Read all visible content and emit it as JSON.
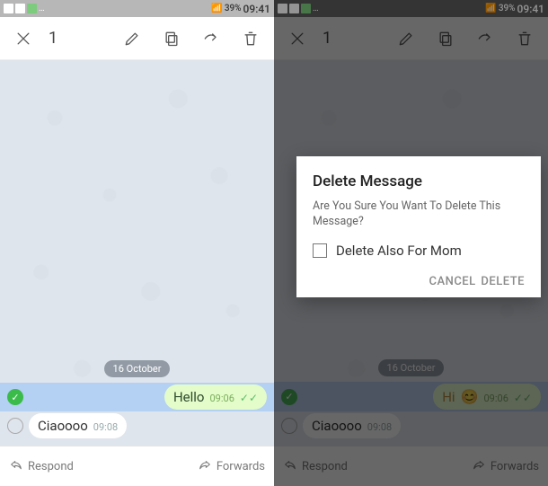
{
  "status": {
    "battery": "39%",
    "time": "09:41",
    "left_extra": "8 39% 09:41"
  },
  "toolbar": {
    "selected_count": "1"
  },
  "chat": {
    "date": "16 October",
    "left": {
      "out_text": "Hello",
      "out_time": "09:06",
      "in_text": "Ciaoooo",
      "in_time": "09:08"
    },
    "right": {
      "out_text": "Hi",
      "out_time": "09:06",
      "in_text": "Ciaoooo",
      "in_time": "09:08"
    }
  },
  "footer": {
    "respond": "Respond",
    "forwards": "Forwards"
  },
  "dialog": {
    "title": "Delete Message",
    "body": "Are You Sure You Want To Delete This Message?",
    "checkbox": "Delete Also For Mom",
    "cancel": "CANCEL",
    "confirm": "DELETE"
  }
}
